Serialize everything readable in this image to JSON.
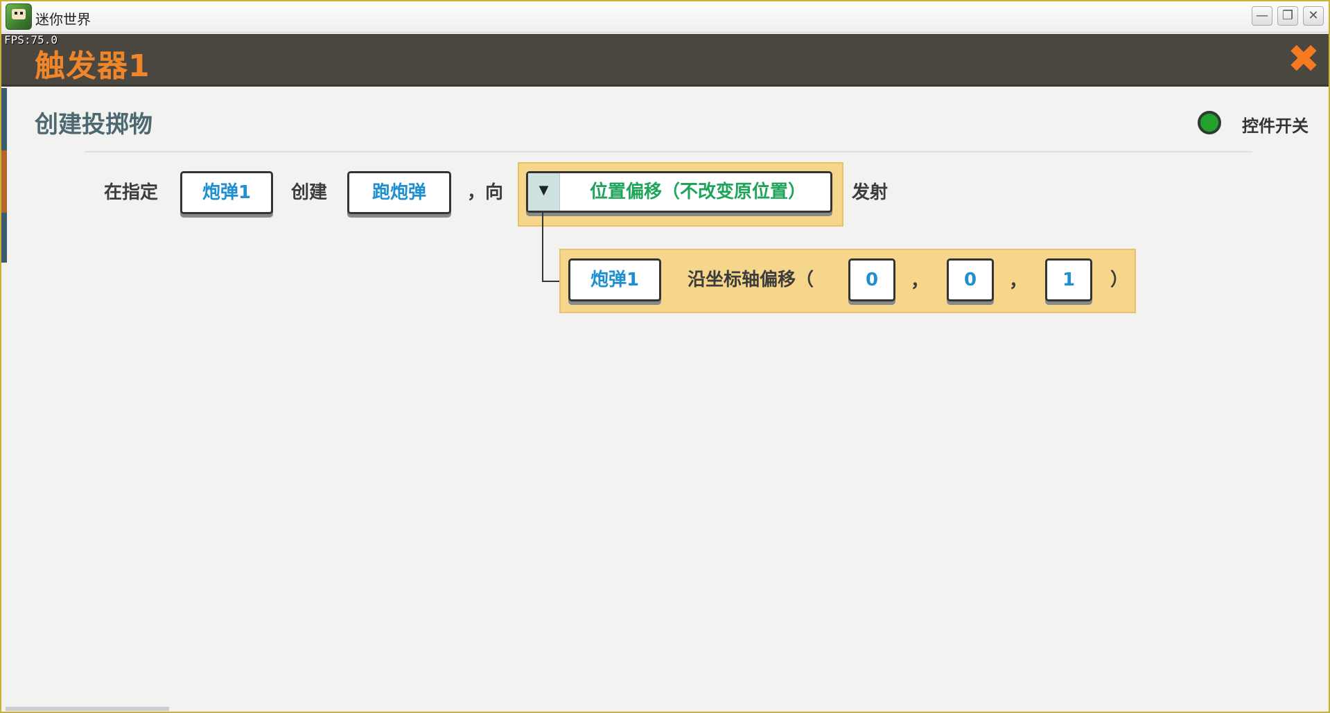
{
  "window": {
    "title": "迷你世界",
    "minimize": "—",
    "restore": "❐",
    "close": "✕"
  },
  "fps": "FPS:75.0",
  "header": {
    "title": "触发器1",
    "close_icon": "✖"
  },
  "section": {
    "title": "创建投掷物",
    "switch_label": "控件开关",
    "switch_color": "#22a12c"
  },
  "action_row": {
    "prefix": "在指定",
    "slot1": "炮弹1",
    "create": "创建",
    "slot2": "跑炮弹",
    "toward": "，向",
    "dropdown_caret": "▼",
    "dropdown_value": "位置偏移（不改变原位置）",
    "fire": "发射"
  },
  "offset_row": {
    "slot": "炮弹1",
    "label": "沿坐标轴偏移（",
    "x": "0",
    "comma1": "，",
    "y": "0",
    "comma2": "，",
    "z": "1",
    "close_paren": "）"
  },
  "colors": {
    "accent_orange": "#f0862a",
    "header_bg": "#4a4640",
    "panel_yellow": "#f6d68a",
    "value_blue": "#1f8fd0",
    "dropdown_green": "#1ea55a"
  }
}
